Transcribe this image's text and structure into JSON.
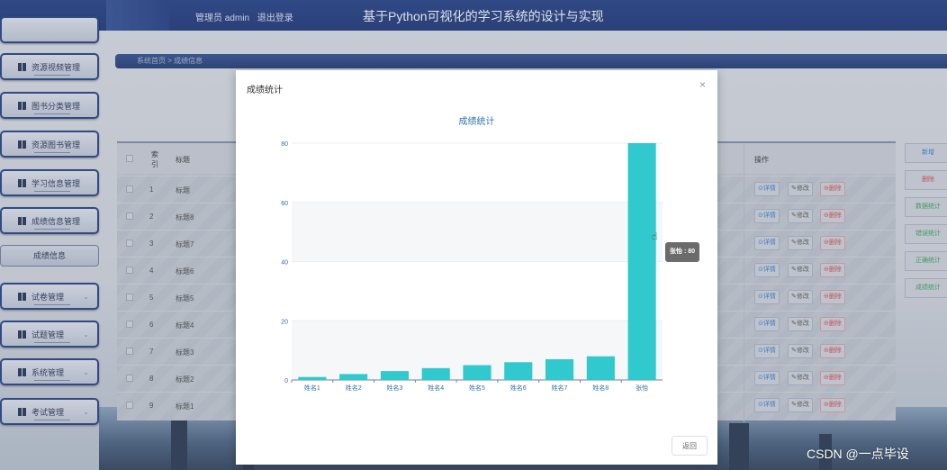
{
  "header": {
    "admin_label": "管理员 admin",
    "logout_label": "退出登录",
    "app_title": "基于Python可视化的学习系统的设计与实现"
  },
  "breadcrumb": {
    "text": "系统首页 > 成绩信息"
  },
  "sidebar": {
    "items": [
      {
        "label": "资源视频管理",
        "icon": "grid-icon"
      },
      {
        "label": "图书分类管理",
        "icon": "grid-icon"
      },
      {
        "label": "资源图书管理",
        "icon": "grid-icon"
      },
      {
        "label": "学习信息管理",
        "icon": "list-icon"
      },
      {
        "label": "成绩信息管理",
        "icon": "grid-icon"
      },
      {
        "label": "成绩信息",
        "icon": ""
      },
      {
        "label": "试卷管理",
        "icon": "book-icon"
      },
      {
        "label": "试题管理",
        "icon": "grid-icon"
      },
      {
        "label": "系统管理",
        "icon": "gear-icon"
      },
      {
        "label": "考试管理",
        "icon": "exam-icon"
      }
    ]
  },
  "table": {
    "headers": [
      "索引",
      "标题",
      "操作"
    ],
    "rows": [
      {
        "index": "1",
        "title": "标题"
      },
      {
        "index": "2",
        "title": "标题8"
      },
      {
        "index": "3",
        "title": "标题7"
      },
      {
        "index": "4",
        "title": "标题6"
      },
      {
        "index": "5",
        "title": "标题5"
      },
      {
        "index": "6",
        "title": "标题4"
      },
      {
        "index": "7",
        "title": "标题3"
      },
      {
        "index": "8",
        "title": "标题2"
      },
      {
        "index": "9",
        "title": "标题1"
      }
    ],
    "op_detail": "⊙详情",
    "op_edit": "✎修改",
    "op_delete": "⊖删除"
  },
  "right_actions": [
    {
      "label": "新增",
      "color": "#2f7fcf"
    },
    {
      "label": "删除",
      "color": "#d94b4b"
    },
    {
      "label": "数据统计",
      "color": "#3aa35a"
    },
    {
      "label": "错误统计",
      "color": "#3aa35a"
    },
    {
      "label": "正确统计",
      "color": "#3aa35a"
    },
    {
      "label": "成绩统计",
      "color": "#3aa35a"
    }
  ],
  "modal": {
    "title": "成绩统计",
    "close_symbol": "×",
    "return_label": "返回"
  },
  "chart_data": {
    "type": "bar",
    "title": "成绩统计",
    "categories": [
      "姓名1",
      "姓名2",
      "姓名3",
      "姓名4",
      "姓名5",
      "姓名6",
      "姓名7",
      "姓名8",
      "张怡"
    ],
    "values": [
      1,
      2,
      3,
      4,
      5,
      6,
      7,
      8,
      80
    ],
    "ylim": [
      0,
      80
    ],
    "yticks": [
      0,
      20,
      40,
      60,
      80
    ],
    "bar_color": "#30c9cd",
    "grid": true
  },
  "tooltip": {
    "text": "张怡 : 80"
  },
  "watermark": {
    "text": "CSDN @一点毕设"
  }
}
